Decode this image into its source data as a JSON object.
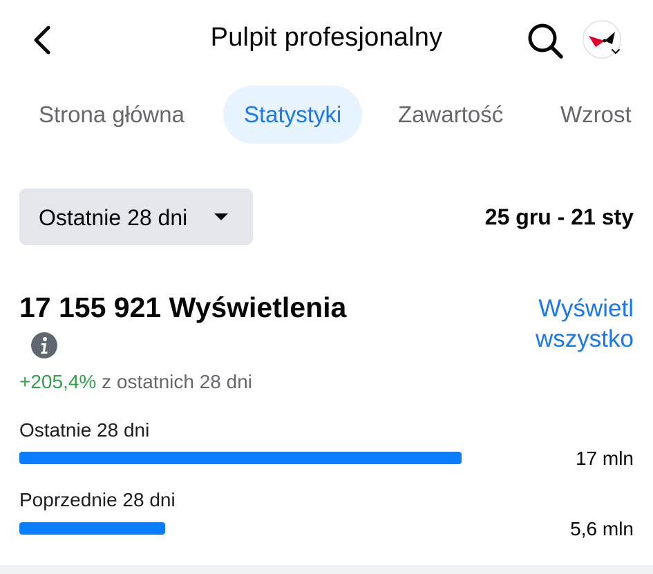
{
  "header": {
    "title": "Pulpit profesjonalny",
    "back_icon": "chevron-left-icon",
    "search_icon": "search-icon",
    "avatar_icon": "profile-avatar-icon"
  },
  "tabs": [
    {
      "label": "Strona główna",
      "active": false
    },
    {
      "label": "Statystyki",
      "active": true
    },
    {
      "label": "Zawartość",
      "active": false
    },
    {
      "label": "Wzrost",
      "active": false
    }
  ],
  "period": {
    "selected": "Ostatnie 28 dni",
    "date_range": "25 gru - 21 sty"
  },
  "views": {
    "title": "17 155 921 Wyświetlenia",
    "see_all": "Wyświetl wszystko",
    "change_pct": "+205,4%",
    "change_text": " z ostatnich 28 dni"
  },
  "comparison": [
    {
      "label": "Ostatnie 28 dni",
      "value_text": "17 mln",
      "fraction": 1.0
    },
    {
      "label": "Poprzednie 28 dni",
      "value_text": "5,6 mln",
      "fraction": 0.33
    }
  ],
  "colors": {
    "accent": "#1877f2",
    "bar": "#0a7cff",
    "positive": "#31a24c",
    "tab_active_bg": "#e7f3ff",
    "button_bg": "#e4e6eb"
  }
}
